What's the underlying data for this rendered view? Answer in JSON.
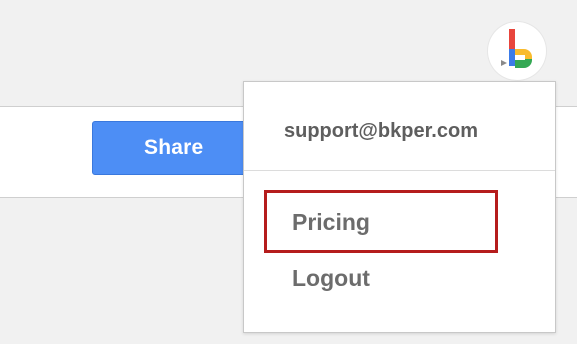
{
  "header": {
    "avatar_icon": "bkper-logo-icon",
    "colors": {
      "logo_red": "#e8453c",
      "logo_blue": "#3b7be8",
      "logo_green": "#34a853",
      "logo_yellow": "#f9bb2d"
    }
  },
  "toolbar": {
    "share_label": "Share",
    "share_color": "#4d8ef5"
  },
  "account_menu": {
    "email": "support@bkper.com",
    "items": [
      {
        "label": "Pricing",
        "highlighted": true
      },
      {
        "label": "Logout",
        "highlighted": false
      }
    ],
    "highlight_color": "#b51c1c"
  }
}
